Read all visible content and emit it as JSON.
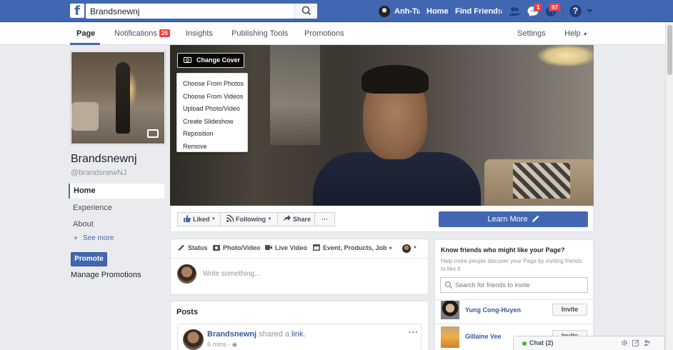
{
  "topbar": {
    "logo": "f",
    "search_value": "Brandsnewnj",
    "profile_name": "Anh-Tu",
    "nav_home": "Home",
    "nav_find_friends": "Find Friends",
    "messages_badge": "1",
    "notifications_badge": "97",
    "help_icon": "?",
    "accent": "#4267b2"
  },
  "subnav": {
    "page": "Page",
    "notifications": "Notifications",
    "notifications_badge": "26",
    "insights": "Insights",
    "publishing_tools": "Publishing Tools",
    "promotions": "Promotions",
    "settings": "Settings",
    "help": "Help"
  },
  "left": {
    "page_name": "Brandsnewnj",
    "page_handle": "@brandsnewNJ",
    "nav": [
      "Home",
      "Experience",
      "About"
    ],
    "see_more": "See more",
    "promote": "Promote",
    "manage_promotions": "Manage Promotions"
  },
  "cover": {
    "change_cover": "Change Cover",
    "menu": [
      "Choose From Photos",
      "Choose From Videos",
      "Upload Photo/Video",
      "Create Slideshow",
      "Reposition",
      "Remove"
    ]
  },
  "actions": {
    "liked": "Liked",
    "following": "Following",
    "share": "Share",
    "more": "···",
    "learn_more": "Learn More"
  },
  "composer": {
    "tabs": [
      "Status",
      "Photo/Video",
      "Live Video",
      "Event, Products, Job +"
    ],
    "placeholder": "Write something..."
  },
  "posts": {
    "title": "Posts",
    "author": "Brandsnewnj",
    "shared_text": "shared a",
    "link_text": "link.",
    "time": "6 mins ·",
    "more": "···"
  },
  "invite": {
    "title": "Know friends who might like your Page?",
    "description": "Help more people discover your Page by inviting friends to like it.",
    "search_placeholder": "Search for friends to invite",
    "friends": [
      {
        "name": "Yung Cong-Huyen",
        "button": "Invite"
      },
      {
        "name": "Gillaine Vee",
        "button": "Invite"
      }
    ]
  },
  "chat": {
    "label": "Chat (2)"
  }
}
